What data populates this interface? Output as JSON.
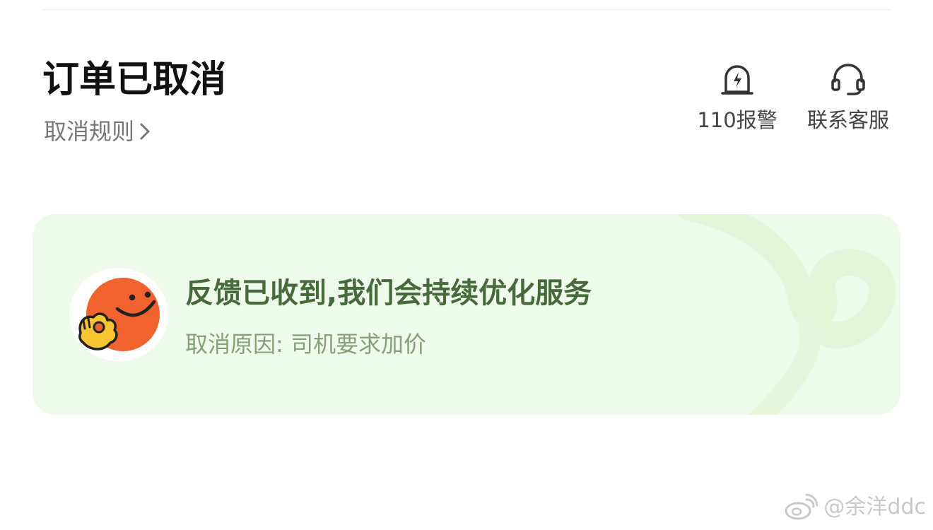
{
  "header": {
    "title": "订单已取消",
    "rules_link": "取消规则",
    "actions": [
      {
        "label": "110报警",
        "icon": "alarm-light-icon"
      },
      {
        "label": "联系客服",
        "icon": "headset-icon"
      }
    ]
  },
  "feedback": {
    "title": "反馈已收到,我们会持续优化服务",
    "reason": "取消原因: 司机要求加价",
    "icon": "smiley-ok-hand-icon"
  },
  "watermark": {
    "text": "@余洋ddc",
    "icon": "weibo-logo-icon"
  },
  "colors": {
    "card_background": "#effbea",
    "card_title": "#466a3c",
    "card_subtitle": "#84a079",
    "emoji_face": "#f0622e",
    "emoji_hand": "#f7c531"
  }
}
